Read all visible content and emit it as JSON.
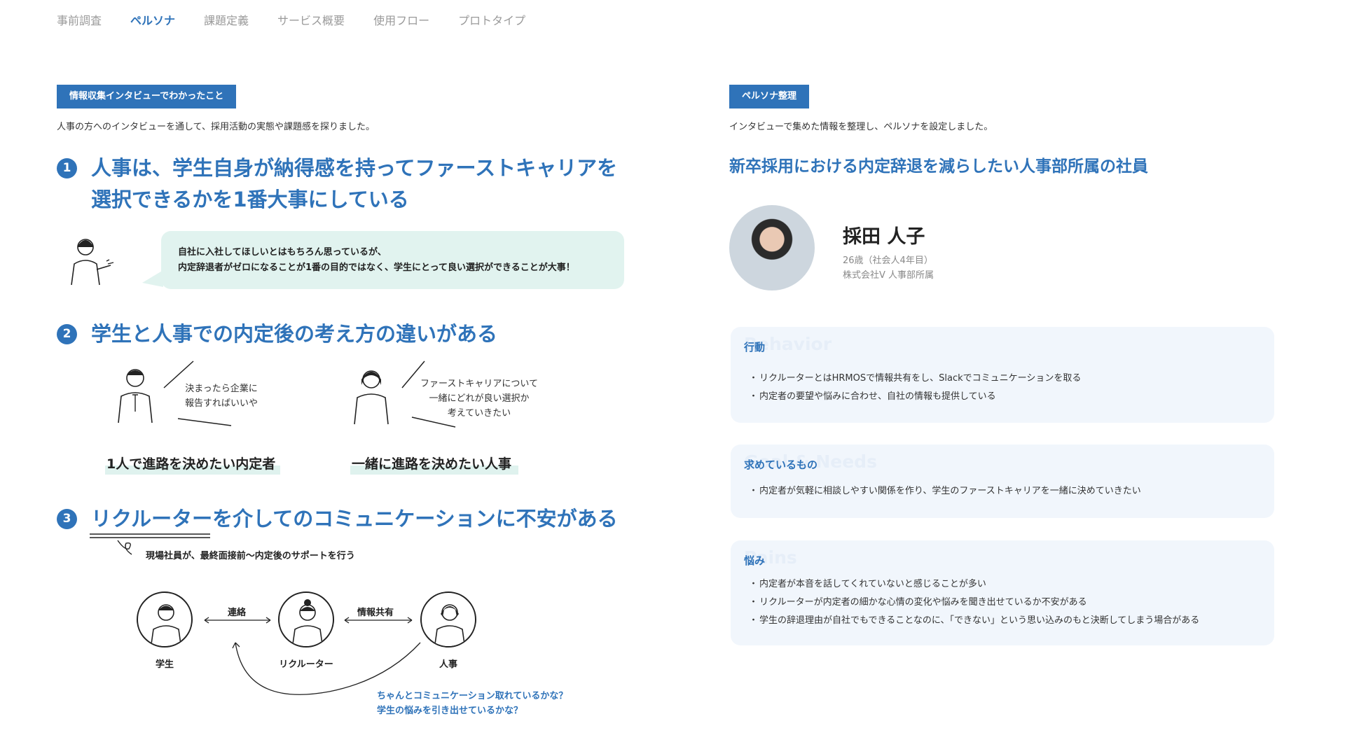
{
  "nav": {
    "items": [
      "事前調査",
      "ペルソナ",
      "課題定義",
      "サービス概要",
      "使用フロー",
      "プロトタイプ"
    ],
    "active": "ペルソナ"
  },
  "left": {
    "tag": "情報収集インタビューでわかったこと",
    "intro": "人事の方へのインタビューを通して、採用活動の実態や課題感を探りました。",
    "points": [
      {
        "num": "1",
        "lines": [
          "人事は、学生自身が納得感を持ってファーストキャリアを",
          "選択できるかを1番大事にしている"
        ]
      },
      {
        "num": "2",
        "lines": [
          "学生と人事での内定後の考え方の違いがある"
        ]
      },
      {
        "num": "3",
        "lines": [
          "リクルーターを介してのコミュニケーションに不安がある"
        ]
      }
    ],
    "quote": [
      "自社に入社してほしいとはもちろん思っているが、",
      "内定辞退者がゼロになることが1番の目的ではなく、学生にとって良い選択ができることが大事！"
    ],
    "student_speech": [
      "決まったら企業に",
      "報告すればいいや"
    ],
    "hr_speech": [
      "ファーストキャリアについて",
      "一緒にどれが良い選択か",
      "考えていきたい"
    ],
    "student_label": "1人で進路を決めたい内定者",
    "hr_label": "一緒に進路を決めたい人事",
    "point3_note": "現場社員が、最終面接前〜内定後のサポートを行う",
    "flow": {
      "nodes": [
        "学生",
        "リクルーター",
        "人事"
      ],
      "link1": "連絡",
      "link2": "情報共有",
      "concern": [
        "ちゃんとコミュニケーション取れているかな？",
        "学生の悩みを引き出せているかな？"
      ]
    }
  },
  "right": {
    "tag": "ペルソナ整理",
    "intro": "インタビューで集めた情報を整理し、ペルソナを設定しました。",
    "title": "新卒採用における内定辞退を減らしたい人事部所属の社員",
    "name": "採田 人子",
    "age": "26歳（社会人4年目）",
    "company": "株式会社V 人事部所属",
    "cards": [
      {
        "title": "行動",
        "ghost": "Behavior",
        "items": [
          "リクルーターとはHRMOSで情報共有をし、Slackでコミュニケーションを取る",
          "内定者の要望や悩みに合わせ、自社の情報も提供している"
        ]
      },
      {
        "title": "求めているもの",
        "ghost": "Goal & Needs",
        "items": [
          "内定者が気軽に相談しやすい関係を作り、学生のファーストキャリアを一緒に決めていきたい"
        ]
      },
      {
        "title": "悩み",
        "ghost": "Pains",
        "items": [
          "内定者が本音を話してくれていないと感じることが多い",
          "リクルーターが内定者の細かな心情の変化や悩みを聞き出せているか不安がある",
          "学生の辞退理由が自社でもできることなのに、「できない」という思い込みのもと決断してしまう場合がある"
        ]
      }
    ]
  },
  "colors": {
    "accent": "#2f73b9",
    "mint": "#e1f3ef",
    "card_bg": "#f1f6fc"
  }
}
